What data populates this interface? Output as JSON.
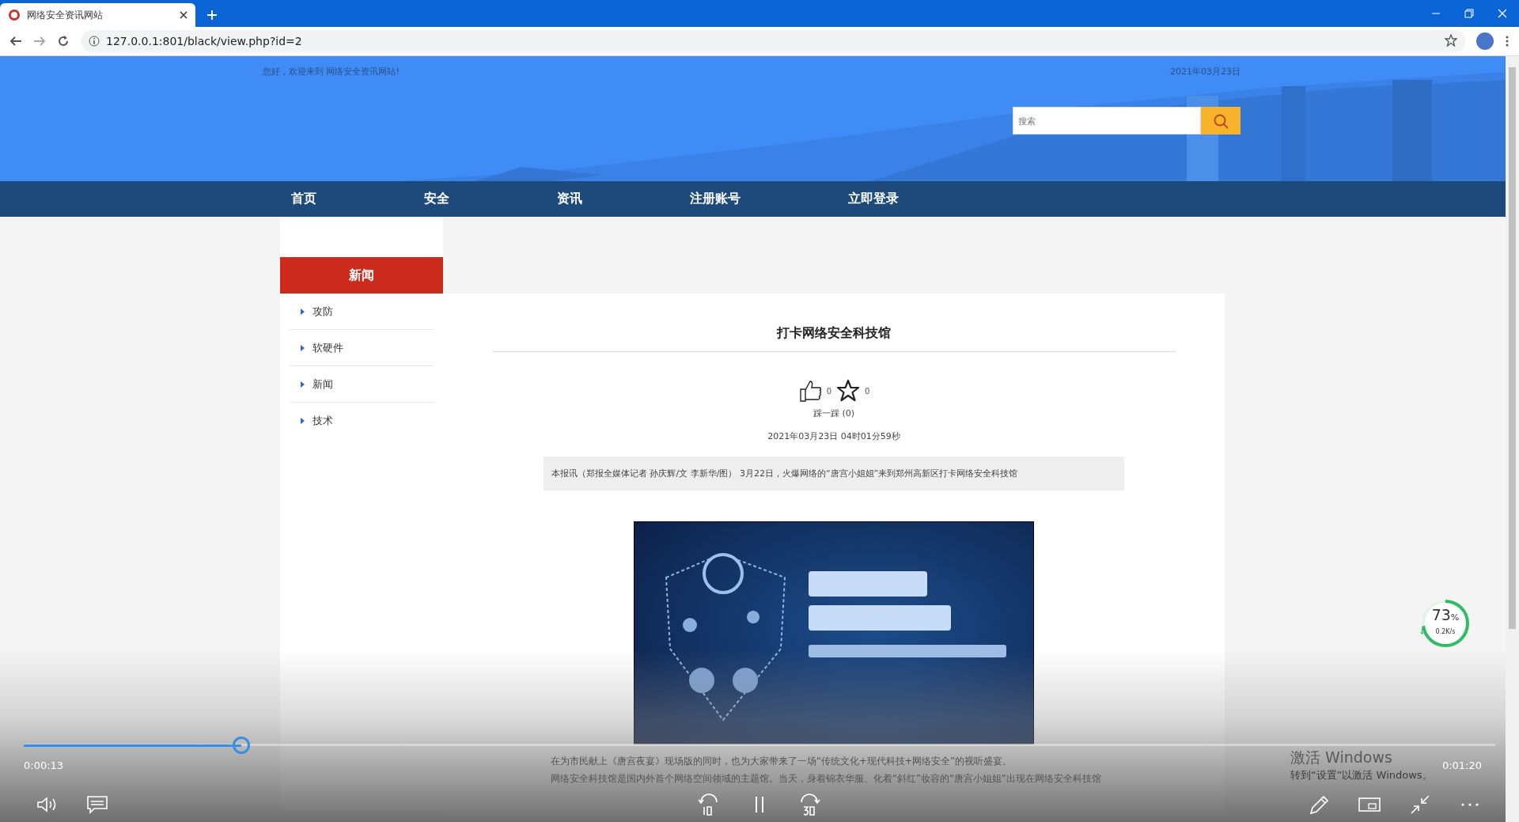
{
  "browser": {
    "tab_title": "网络安全资讯网站",
    "url": "127.0.0.1:801/black/view.php?id=2"
  },
  "header": {
    "greeting": "您好，欢迎来到 网络安全资讯网站!",
    "date": "2021年03月23日",
    "search": {
      "placeholder": "搜索"
    }
  },
  "nav": [
    {
      "label": "首页"
    },
    {
      "label": "安全"
    },
    {
      "label": "资讯"
    },
    {
      "label": "注册账号"
    },
    {
      "label": "立即登录"
    }
  ],
  "sidebar": {
    "title": "新闻",
    "items": [
      "攻防",
      "软硬件",
      "新闻",
      "技术"
    ]
  },
  "article": {
    "title": "打卡网络安全科技馆",
    "likes": "0",
    "favorites": "0",
    "dislike": "踩一踩 (0)",
    "date": "2021年03月23日 04时01分59秒",
    "summary": "本报讯（郑报全媒体记者 孙庆辉/文 李新华/图） 3月22日，火爆网络的“唐宫小姐姐”来到郑州高新区打卡网络安全科技馆",
    "paragraphs": [
      "在为市民献上《唐宫夜宴》现场版的同时，也为大家带来了一场“传统文化+现代科技+网络安全”的视听盛宴。",
      "网络安全科技馆是国内外首个网络空间领域的主题馆。当天，身着锦衣华服、化着“斜红”妆容的“唐宫小姐姐”出现在网络安全科技馆"
    ]
  },
  "speed_widget": {
    "percent": "73",
    "unit": "%",
    "rate": "0.2K/s",
    "level": 0.73
  },
  "os_notice": {
    "title": "激活 Windows",
    "text": "转到“设置”以激活 Windows。"
  },
  "player": {
    "level": 0.148,
    "elapsed": "0:00:13",
    "duration": "0:01:20"
  }
}
